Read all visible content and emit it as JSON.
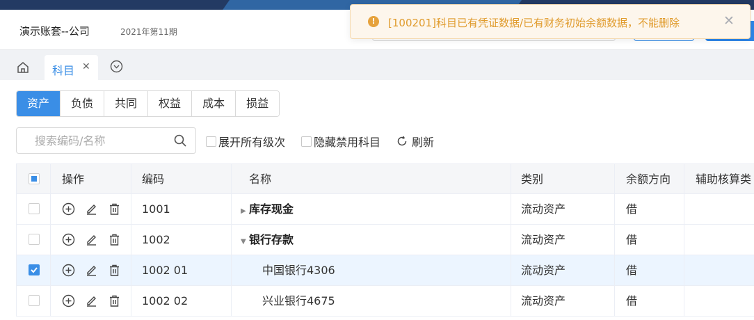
{
  "header": {
    "app_title": "演示账套--公司",
    "period": "2021年第11期"
  },
  "toast": {
    "type": "warning",
    "message": "[100201]科目已有凭证数据/已有财务初始余额数据，不能删除"
  },
  "tabs": [
    {
      "label": "科目",
      "active": true
    }
  ],
  "categories": [
    {
      "label": "资产",
      "active": true
    },
    {
      "label": "负债",
      "active": false
    },
    {
      "label": "共同",
      "active": false
    },
    {
      "label": "权益",
      "active": false
    },
    {
      "label": "成本",
      "active": false
    },
    {
      "label": "损益",
      "active": false
    }
  ],
  "search": {
    "placeholder": "搜索编码/名称",
    "value": ""
  },
  "options": {
    "expand_all": "展开所有级次",
    "hide_disabled": "隐藏禁用科目",
    "refresh": "刷新"
  },
  "table": {
    "columns": {
      "op": "操作",
      "code": "编码",
      "name": "名称",
      "type": "类别",
      "dir": "余额方向",
      "aux": "辅助核算类"
    },
    "rows": [
      {
        "checked": false,
        "code": "1001",
        "name": "库存现金",
        "level": 1,
        "expanded": false,
        "type": "流动资产",
        "dir": "借",
        "aux": ""
      },
      {
        "checked": false,
        "code": "1002",
        "name": "银行存款",
        "level": 1,
        "expanded": true,
        "type": "流动资产",
        "dir": "借",
        "aux": ""
      },
      {
        "checked": true,
        "code": "1002 01",
        "name": "中国银行4306",
        "level": 2,
        "expanded": null,
        "type": "流动资产",
        "dir": "借",
        "aux": ""
      },
      {
        "checked": false,
        "code": "1002 02",
        "name": "兴业银行4675",
        "level": 2,
        "expanded": null,
        "type": "流动资产",
        "dir": "借",
        "aux": ""
      }
    ]
  },
  "colors": {
    "primary": "#3a8ee6",
    "warning_text": "#e09b2c",
    "warning_bg": "#fdf6ec",
    "selected_row": "#ecf5ff"
  }
}
